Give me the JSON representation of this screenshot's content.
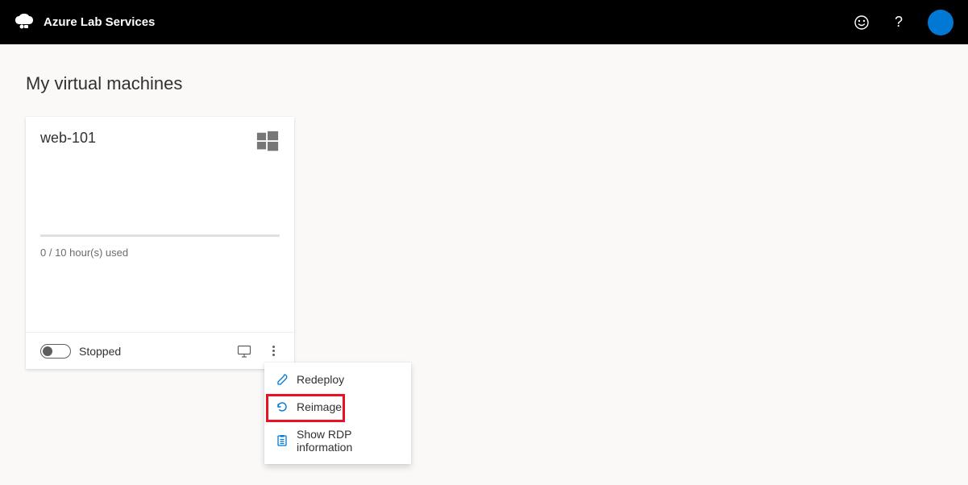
{
  "header": {
    "brand": "Azure Lab Services"
  },
  "page": {
    "title": "My virtual machines"
  },
  "vm": {
    "name": "web-101",
    "usage": "0 / 10 hour(s) used",
    "status": "Stopped"
  },
  "menu": {
    "redeploy": "Redeploy",
    "reimage": "Reimage",
    "rdp": "Show RDP information"
  }
}
